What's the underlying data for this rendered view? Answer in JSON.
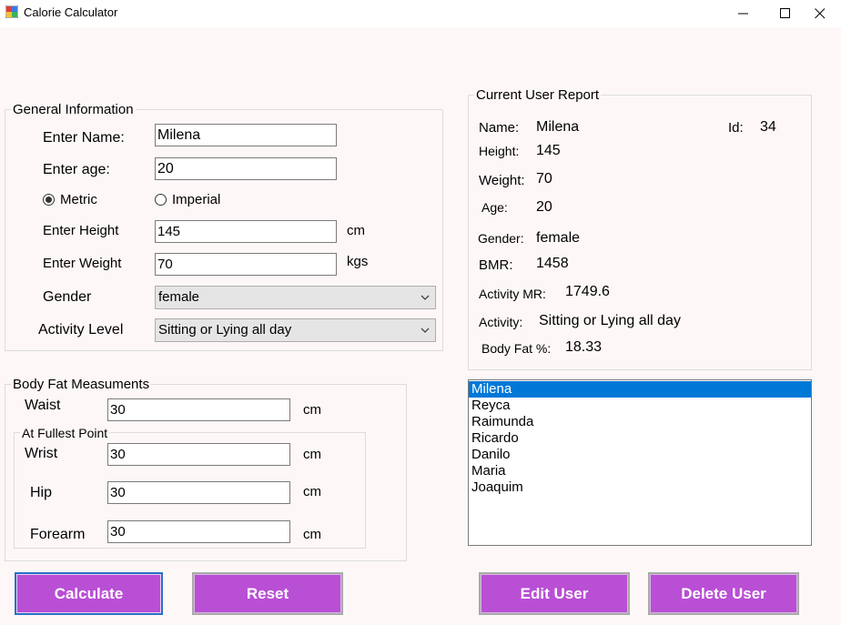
{
  "window": {
    "title": "Calorie Calculator",
    "minimize_glyph": "—",
    "maximize_glyph": "☐",
    "close_glyph": "✕"
  },
  "general": {
    "legend": "General Information",
    "name_label": "Enter Name:",
    "name_value": "Milena",
    "age_label": "Enter age:",
    "age_value": "20",
    "metric_label": "Metric",
    "imperial_label": "Imperial",
    "height_label": "Enter Height",
    "height_value": "145",
    "height_unit": "cm",
    "weight_label": "Enter Weight",
    "weight_value": "70",
    "weight_unit": "kgs",
    "gender_label": "Gender",
    "gender_value": "female",
    "activity_label": "Activity Level",
    "activity_value": "Sitting or Lying all day"
  },
  "bodyfat": {
    "legend": "Body Fat Measuments",
    "waist_label": "Waist",
    "waist_value": "30",
    "waist_unit": "cm",
    "fullest_legend": "At Fullest Point",
    "wrist_label": "Wrist",
    "wrist_value": "30",
    "wrist_unit": "cm",
    "hip_label": "Hip",
    "hip_value": "30",
    "hip_unit": "cm",
    "forearm_label": "Forearm",
    "forearm_value": "30",
    "forearm_unit": "cm"
  },
  "report": {
    "legend": "Current User Report",
    "name_label": "Name:",
    "name_value": "Milena",
    "id_label": "Id:",
    "id_value": "34",
    "height_label": "Height:",
    "height_value": "145",
    "weight_label": "Weight:",
    "weight_value": "70",
    "age_label": "Age:",
    "age_value": "20",
    "gender_label": "Gender:",
    "gender_value": "female",
    "bmr_label": "BMR:",
    "bmr_value": "1458",
    "amr_label": "Activity MR:",
    "amr_value": "1749.6",
    "activity_label": "Activity:",
    "activity_value": "Sitting or Lying all day",
    "bodyfat_label": "Body Fat %:",
    "bodyfat_value": "18.33"
  },
  "users": [
    "Milena",
    "Reyca",
    "Raimunda",
    "Ricardo",
    "Danilo",
    "Maria",
    "Joaquim"
  ],
  "selected_user_index": 0,
  "buttons": {
    "calculate": "Calculate",
    "reset": "Reset",
    "edit_user": "Edit User",
    "delete_user": "Delete User"
  },
  "colors": {
    "button_purple": "#b94fd5",
    "selection_blue": "#0078d7",
    "form_background": "#fdf8f7"
  }
}
